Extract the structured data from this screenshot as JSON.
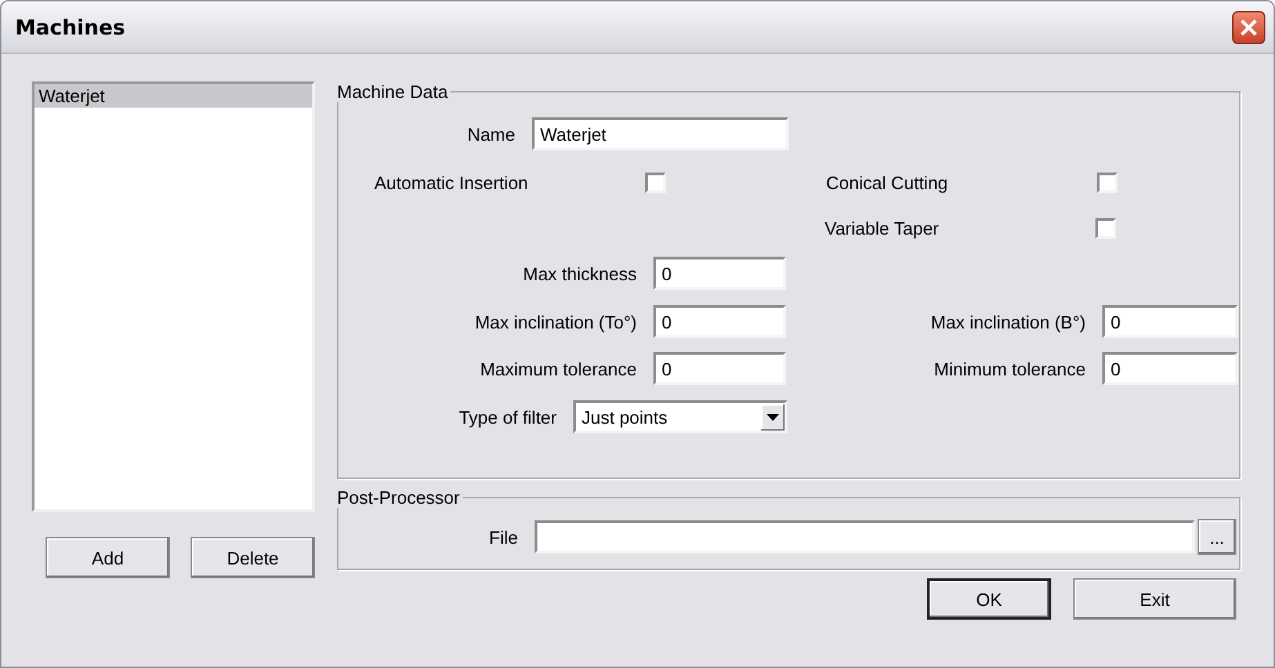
{
  "window": {
    "title": "Machines"
  },
  "machine_list": {
    "items": [
      {
        "label": "Waterjet",
        "selected": true
      }
    ]
  },
  "list_buttons": [
    "Add",
    "Delete"
  ],
  "machine_data": {
    "title": "Machine Data",
    "name": {
      "label": "Name",
      "value": "Waterjet"
    },
    "checkboxes": [
      {
        "label": "Automatic Insertion",
        "checked": false
      },
      {
        "label": "Conical Cutting",
        "checked": false
      },
      {
        "label": "Variable Taper",
        "checked": false
      }
    ],
    "max_thickness": {
      "label": "Max thickness",
      "value": "0"
    },
    "max_inclination_to": {
      "label": "Max inclination (To°)",
      "value": "0"
    },
    "max_inclination_b": {
      "label": "Max inclination (B°)",
      "value": "0"
    },
    "maximum_tolerance": {
      "label": "Maximum tolerance",
      "value": "0"
    },
    "minimum_tolerance": {
      "label": "Minimum tolerance",
      "value": "0"
    },
    "filter_type": {
      "label": "Type of filter",
      "value": "Just points"
    }
  },
  "post_processor": {
    "title": "Post-Processor",
    "file": {
      "label": "File",
      "browse": "..."
    }
  },
  "buttons": [
    {
      "label": "OK",
      "default": true
    },
    {
      "label": "Exit",
      "default": false
    }
  ]
}
